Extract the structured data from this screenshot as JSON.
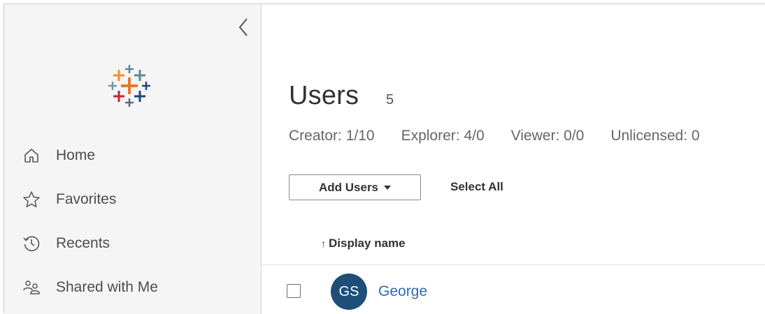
{
  "sidebar": {
    "collapse_icon": "chevron-left-icon",
    "logo_icon": "tableau-logo",
    "items": [
      {
        "label": "Home",
        "icon": "home-icon"
      },
      {
        "label": "Favorites",
        "icon": "star-icon"
      },
      {
        "label": "Recents",
        "icon": "history-icon"
      },
      {
        "label": "Shared with Me",
        "icon": "shared-users-icon"
      }
    ]
  },
  "main": {
    "title": "Users",
    "count": "5",
    "licenses": {
      "creator": "Creator: 1/10",
      "explorer": "Explorer: 4/0",
      "viewer": "Viewer: 0/0",
      "unlicensed": "Unlicensed: 0"
    },
    "toolbar": {
      "add_users_label": "Add Users",
      "select_all_label": "Select All"
    },
    "table": {
      "sort_arrow": "↑",
      "column_header": "Display name",
      "rows": [
        {
          "initials": "GS",
          "name": "George"
        }
      ]
    }
  },
  "colors": {
    "sidebar_bg": "#f5f5f5",
    "avatar_bg": "#1f4e79",
    "link": "#2d6bb0"
  }
}
